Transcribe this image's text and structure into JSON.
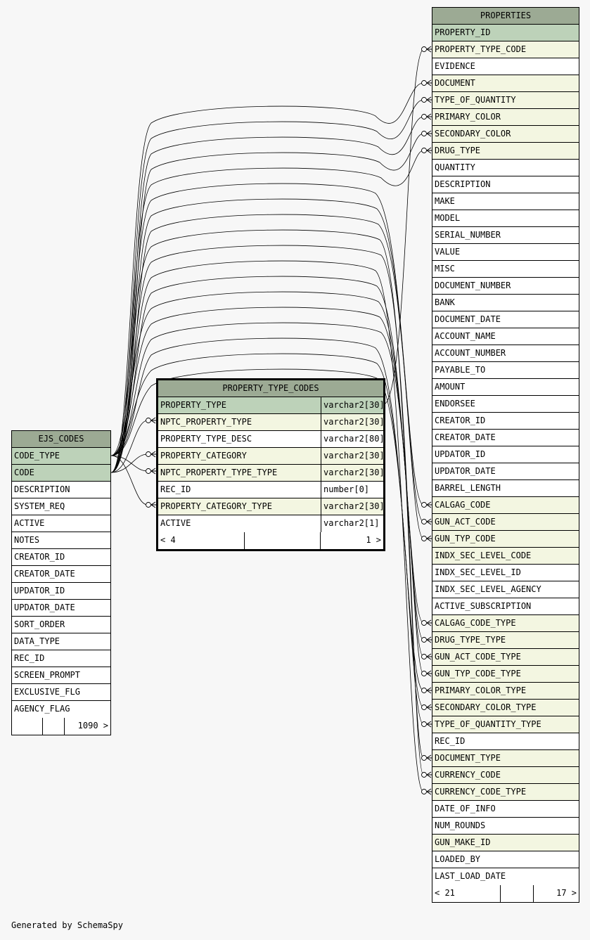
{
  "tables": {
    "ejs_codes": {
      "name": "EJS_CODES",
      "columns": [
        {
          "name": "CODE_TYPE",
          "kind": "pk"
        },
        {
          "name": "CODE",
          "kind": "pk"
        },
        {
          "name": "DESCRIPTION",
          "kind": "plain"
        },
        {
          "name": "SYSTEM_REQ",
          "kind": "plain"
        },
        {
          "name": "ACTIVE",
          "kind": "plain"
        },
        {
          "name": "NOTES",
          "kind": "plain"
        },
        {
          "name": "CREATOR_ID",
          "kind": "plain"
        },
        {
          "name": "CREATOR_DATE",
          "kind": "plain"
        },
        {
          "name": "UPDATOR_ID",
          "kind": "plain"
        },
        {
          "name": "UPDATOR_DATE",
          "kind": "plain"
        },
        {
          "name": "SORT_ORDER",
          "kind": "plain"
        },
        {
          "name": "DATA_TYPE",
          "kind": "plain"
        },
        {
          "name": "REC_ID",
          "kind": "plain"
        },
        {
          "name": "SCREEN_PROMPT",
          "kind": "plain"
        },
        {
          "name": "EXCLUSIVE_FLG",
          "kind": "plain"
        },
        {
          "name": "AGENCY_FLAG",
          "kind": "plain"
        }
      ],
      "footer": {
        "left": "",
        "right": "1090 >"
      }
    },
    "property_type_codes": {
      "name": "PROPERTY_TYPE_CODES",
      "columns": [
        {
          "name": "PROPERTY_TYPE",
          "type": "varchar2[30]",
          "kind": "pk"
        },
        {
          "name": "NPTC_PROPERTY_TYPE",
          "type": "varchar2[30]",
          "kind": "fk"
        },
        {
          "name": "PROPERTY_TYPE_DESC",
          "type": "varchar2[80]",
          "kind": "plain"
        },
        {
          "name": "PROPERTY_CATEGORY",
          "type": "varchar2[30]",
          "kind": "fk"
        },
        {
          "name": "NPTC_PROPERTY_TYPE_TYPE",
          "type": "varchar2[30]",
          "kind": "fk"
        },
        {
          "name": "REC_ID",
          "type": "number[0]",
          "kind": "plain"
        },
        {
          "name": "PROPERTY_CATEGORY_TYPE",
          "type": "varchar2[30]",
          "kind": "fk"
        },
        {
          "name": "ACTIVE",
          "type": "varchar2[1]",
          "kind": "plain"
        }
      ],
      "footer": {
        "left": "< 4",
        "right": "1 >"
      }
    },
    "properties": {
      "name": "PROPERTIES",
      "columns": [
        {
          "name": "PROPERTY_ID",
          "kind": "pk"
        },
        {
          "name": "PROPERTY_TYPE_CODE",
          "kind": "fk"
        },
        {
          "name": "EVIDENCE",
          "kind": "plain"
        },
        {
          "name": "DOCUMENT",
          "kind": "fk"
        },
        {
          "name": "TYPE_OF_QUANTITY",
          "kind": "fk"
        },
        {
          "name": "PRIMARY_COLOR",
          "kind": "fk"
        },
        {
          "name": "SECONDARY_COLOR",
          "kind": "fk"
        },
        {
          "name": "DRUG_TYPE",
          "kind": "fk"
        },
        {
          "name": "QUANTITY",
          "kind": "plain"
        },
        {
          "name": "DESCRIPTION",
          "kind": "plain"
        },
        {
          "name": "MAKE",
          "kind": "plain"
        },
        {
          "name": "MODEL",
          "kind": "plain"
        },
        {
          "name": "SERIAL_NUMBER",
          "kind": "plain"
        },
        {
          "name": "VALUE",
          "kind": "plain"
        },
        {
          "name": "MISC",
          "kind": "plain"
        },
        {
          "name": "DOCUMENT_NUMBER",
          "kind": "plain"
        },
        {
          "name": "BANK",
          "kind": "plain"
        },
        {
          "name": "DOCUMENT_DATE",
          "kind": "plain"
        },
        {
          "name": "ACCOUNT_NAME",
          "kind": "plain"
        },
        {
          "name": "ACCOUNT_NUMBER",
          "kind": "plain"
        },
        {
          "name": "PAYABLE_TO",
          "kind": "plain"
        },
        {
          "name": "AMOUNT",
          "kind": "plain"
        },
        {
          "name": "ENDORSEE",
          "kind": "plain"
        },
        {
          "name": "CREATOR_ID",
          "kind": "plain"
        },
        {
          "name": "CREATOR_DATE",
          "kind": "plain"
        },
        {
          "name": "UPDATOR_ID",
          "kind": "plain"
        },
        {
          "name": "UPDATOR_DATE",
          "kind": "plain"
        },
        {
          "name": "BARREL_LENGTH",
          "kind": "plain"
        },
        {
          "name": "CALGAG_CODE",
          "kind": "fk"
        },
        {
          "name": "GUN_ACT_CODE",
          "kind": "fk"
        },
        {
          "name": "GUN_TYP_CODE",
          "kind": "fk"
        },
        {
          "name": "INDX_SEC_LEVEL_CODE",
          "kind": "fk"
        },
        {
          "name": "INDX_SEC_LEVEL_ID",
          "kind": "plain"
        },
        {
          "name": "INDX_SEC_LEVEL_AGENCY",
          "kind": "plain"
        },
        {
          "name": "ACTIVE_SUBSCRIPTION",
          "kind": "plain"
        },
        {
          "name": "CALGAG_CODE_TYPE",
          "kind": "fk"
        },
        {
          "name": "DRUG_TYPE_TYPE",
          "kind": "fk"
        },
        {
          "name": "GUN_ACT_CODE_TYPE",
          "kind": "fk"
        },
        {
          "name": "GUN_TYP_CODE_TYPE",
          "kind": "fk"
        },
        {
          "name": "PRIMARY_COLOR_TYPE",
          "kind": "fk"
        },
        {
          "name": "SECONDARY_COLOR_TYPE",
          "kind": "fk"
        },
        {
          "name": "TYPE_OF_QUANTITY_TYPE",
          "kind": "fk"
        },
        {
          "name": "REC_ID",
          "kind": "plain"
        },
        {
          "name": "DOCUMENT_TYPE",
          "kind": "fk"
        },
        {
          "name": "CURRENCY_CODE",
          "kind": "fk"
        },
        {
          "name": "CURRENCY_CODE_TYPE",
          "kind": "fk"
        },
        {
          "name": "DATE_OF_INFO",
          "kind": "plain"
        },
        {
          "name": "NUM_ROUNDS",
          "kind": "plain"
        },
        {
          "name": "GUN_MAKE_ID",
          "kind": "fk"
        },
        {
          "name": "LOADED_BY",
          "kind": "plain"
        },
        {
          "name": "LAST_LOAD_DATE",
          "kind": "plain"
        }
      ],
      "footer": {
        "left": "< 21",
        "right": "17 >"
      }
    }
  },
  "relationships": {
    "properties_to_ejs_codes": [
      {
        "child": "DOCUMENT",
        "parent": "CODE"
      },
      {
        "child": "TYPE_OF_QUANTITY",
        "parent": "CODE"
      },
      {
        "child": "PRIMARY_COLOR",
        "parent": "CODE"
      },
      {
        "child": "SECONDARY_COLOR",
        "parent": "CODE"
      },
      {
        "child": "DRUG_TYPE",
        "parent": "CODE"
      },
      {
        "child": "CALGAG_CODE",
        "parent": "CODE"
      },
      {
        "child": "GUN_ACT_CODE",
        "parent": "CODE"
      },
      {
        "child": "GUN_TYP_CODE",
        "parent": "CODE"
      },
      {
        "child": "DOCUMENT_TYPE",
        "parent": "CODE_TYPE"
      },
      {
        "child": "CURRENCY_CODE",
        "parent": "CODE"
      },
      {
        "child": "CURRENCY_CODE_TYPE",
        "parent": "CODE_TYPE"
      },
      {
        "child": "CALGAG_CODE_TYPE",
        "parent": "CODE_TYPE"
      },
      {
        "child": "DRUG_TYPE_TYPE",
        "parent": "CODE_TYPE"
      },
      {
        "child": "GUN_ACT_CODE_TYPE",
        "parent": "CODE_TYPE"
      },
      {
        "child": "GUN_TYP_CODE_TYPE",
        "parent": "CODE_TYPE"
      },
      {
        "child": "PRIMARY_COLOR_TYPE",
        "parent": "CODE_TYPE"
      },
      {
        "child": "SECONDARY_COLOR_TYPE",
        "parent": "CODE_TYPE"
      },
      {
        "child": "TYPE_OF_QUANTITY_TYPE",
        "parent": "CODE_TYPE"
      }
    ],
    "property_type_codes_to_ejs_codes": [
      {
        "child": "NPTC_PROPERTY_TYPE",
        "parent": "CODE"
      },
      {
        "child": "PROPERTY_CATEGORY",
        "parent": "CODE"
      },
      {
        "child": "NPTC_PROPERTY_TYPE_TYPE",
        "parent": "CODE_TYPE"
      },
      {
        "child": "PROPERTY_CATEGORY_TYPE",
        "parent": "CODE_TYPE"
      }
    ],
    "properties_to_property_type_codes": [
      {
        "child": "PROPERTY_TYPE_CODE",
        "parent": "PROPERTY_TYPE"
      }
    ]
  },
  "colors": {
    "header": "#9caa94",
    "primary_key": "#bdd2b9",
    "foreign_key": "#f3f6e1",
    "plain": "#ffffff",
    "background": "#f7f7f7"
  },
  "credit": "Generated by SchemaSpy"
}
